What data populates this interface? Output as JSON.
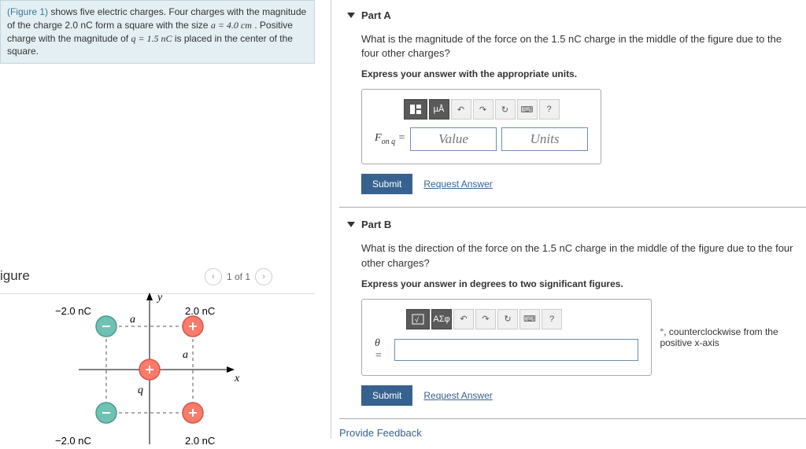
{
  "problem": {
    "figure_link": "(Figure 1)",
    "text_1": " shows five electric charges. Four charges with the magnitude of the charge 2.0 nC form a square with the size ",
    "text_2": "a = 4.0 cm",
    "text_3": " . Positive charge with the magnitude of ",
    "text_4": "q = 1.5 nC",
    "text_5": " is placed in the center of the square."
  },
  "figure": {
    "heading": "igure",
    "nav_label": "1 of 1",
    "y_axis": "y",
    "x_axis": "x",
    "a_label": "a",
    "q_label": "q",
    "top_left": "−2.0 nC",
    "top_right": "2.0 nC",
    "bottom_left": "−2.0 nC",
    "bottom_right": "2.0 nC"
  },
  "partA": {
    "title": "Part A",
    "question": "What is the magnitude of the force on the 1.5 nC charge in the middle of the figure due to the four other charges?",
    "instruction": "Express your answer with the appropriate units.",
    "tool_muA": "µÅ",
    "var": "F",
    "var_sub": "on q",
    "equals": " = ",
    "value_ph": "Value",
    "units_ph": "Units",
    "submit": "Submit",
    "request": "Request Answer"
  },
  "partB": {
    "title": "Part B",
    "question": "What is the direction of the force on the 1.5 nC charge in the middle of the figure due to the four other charges?",
    "instruction": "Express your answer in degrees to two significant figures.",
    "tool_asf": "ΑΣφ",
    "var": "θ =",
    "after": "°, counterclockwise from the positive x-axis",
    "submit": "Submit",
    "request": "Request Answer"
  },
  "feedback": "Provide Feedback",
  "help_q": "?"
}
